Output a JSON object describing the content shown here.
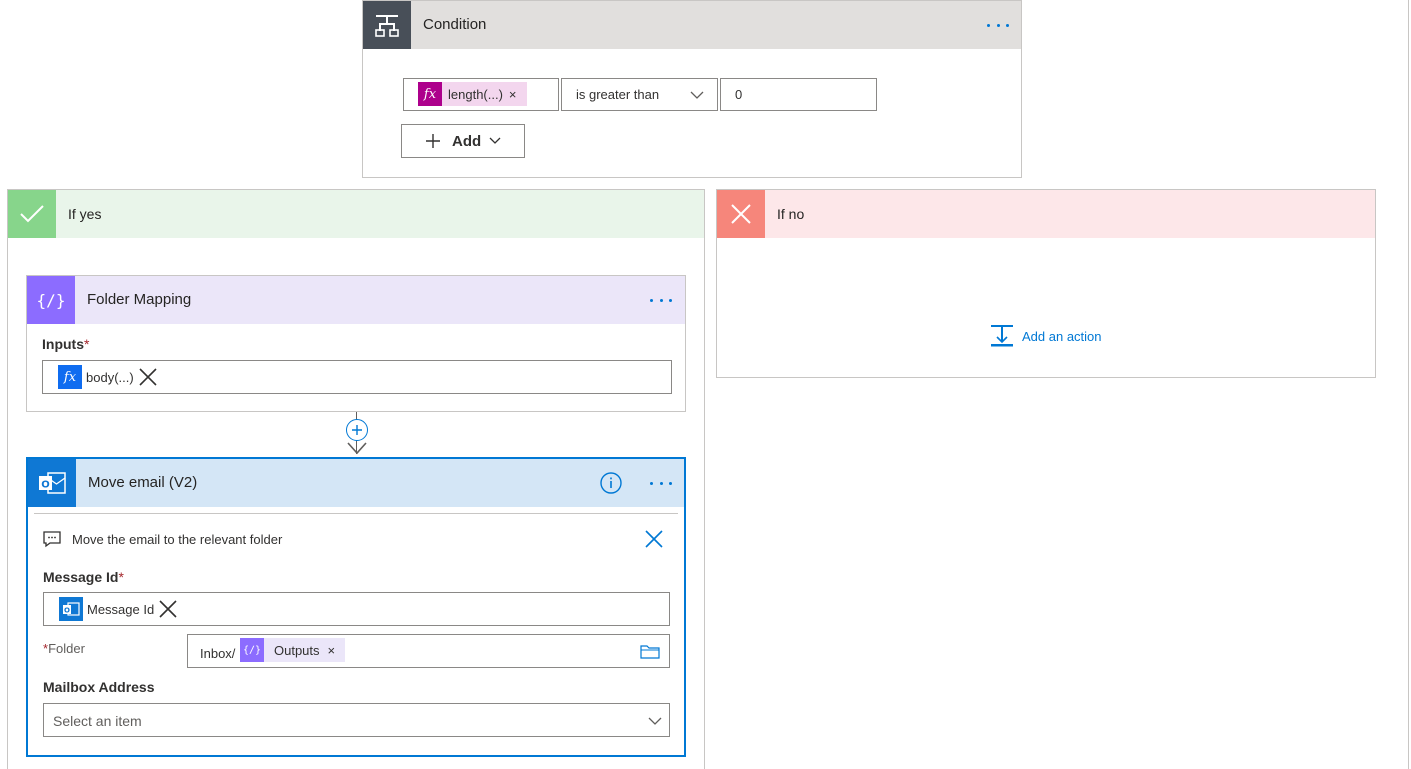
{
  "condition": {
    "title": "Condition",
    "token_label": "length(...)",
    "operator": "is greater than",
    "value": "0",
    "add_label": "Add"
  },
  "if_yes": {
    "title": "If yes",
    "folder_mapping": {
      "title": "Folder Mapping",
      "inputs_label": "Inputs",
      "required_mark": "*",
      "token_label": "body(...)"
    },
    "move_email": {
      "title": "Move email (V2)",
      "comment": "Move the email to the relevant folder",
      "message_id_label": "Message Id",
      "required_mark": "*",
      "message_id_token": "Message Id",
      "folder_label": "Folder",
      "folder_prefix": "Inbox/",
      "folder_token": "Outputs",
      "mailbox_label": "Mailbox Address",
      "mailbox_placeholder": "Select an item"
    }
  },
  "if_no": {
    "title": "If no",
    "add_action_label": "Add an action"
  },
  "colors": {
    "condition_header": "#e1dfdd",
    "condition_icon_bg": "#484f58",
    "yes_header": "#e9f5ea",
    "yes_icon_bg": "#87d58b",
    "no_header": "#fde7e9",
    "no_icon_bg": "#f6867b",
    "variable_header": "#ebe6f9",
    "variable_icon_bg": "#8c6cff",
    "outlook_header": "#d4e6f6",
    "outlook_icon_bg": "#0f78d4",
    "expression_token": "#ad008c",
    "accent": "#0078d4"
  }
}
